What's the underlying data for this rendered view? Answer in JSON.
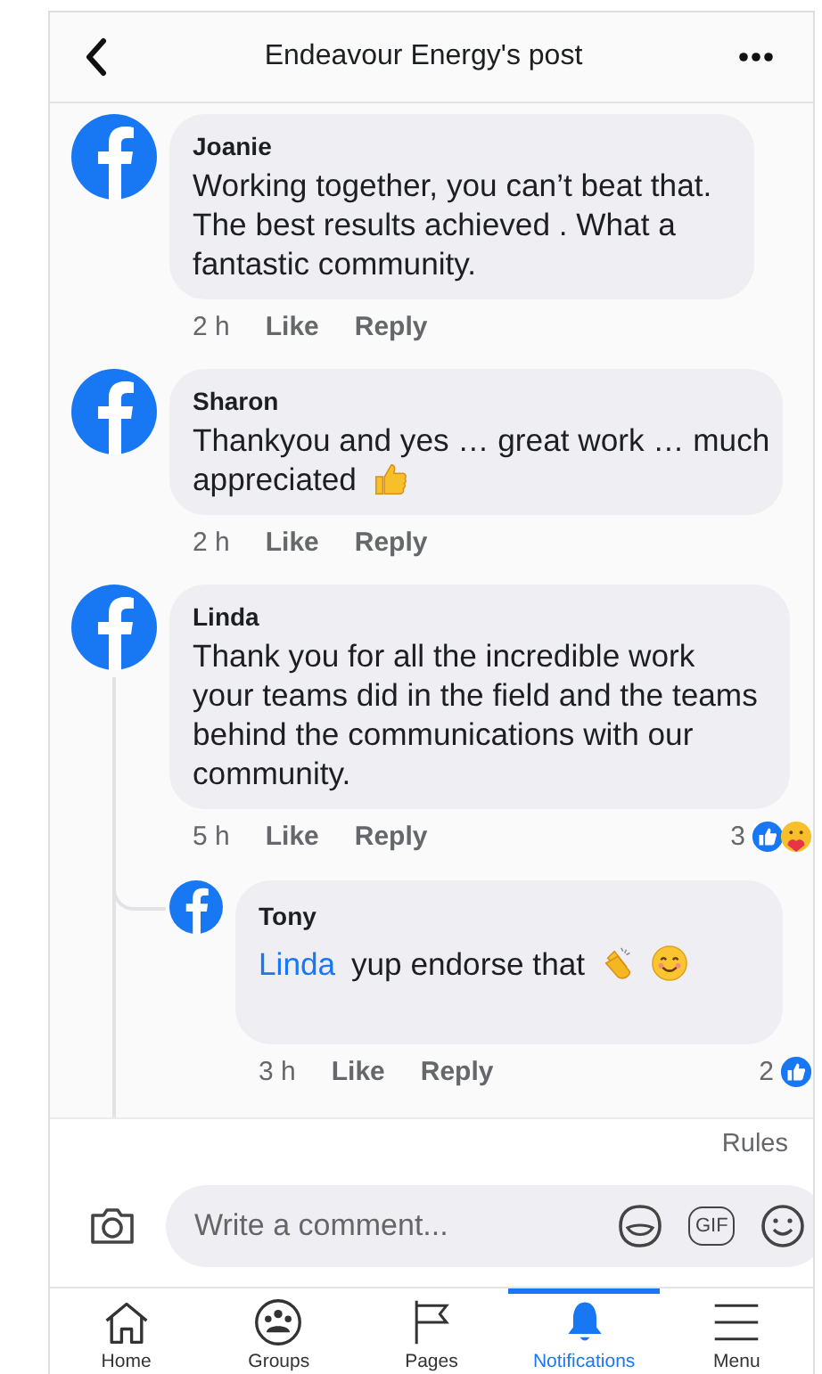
{
  "header": {
    "title": "Endeavour Energy's post"
  },
  "comments": [
    {
      "author": "Joanie",
      "text": "Working together, you can’t beat that. The best results achieved . What a fantastic community.",
      "time": "2 h",
      "actions": [
        "Like",
        "Reply"
      ]
    },
    {
      "author": "Sharon",
      "text": "Thankyou and yes … great work … much appreciated",
      "emoji_thumbs_up": true,
      "time": "2 h",
      "actions": [
        "Like",
        "Reply"
      ]
    },
    {
      "author": "Linda",
      "text": "Thank you for all the incredible work your teams did in the field and the teams behind the communications with our community.",
      "time": "5 h",
      "actions": [
        "Like",
        "Reply"
      ],
      "reactions": {
        "count": "3",
        "like": true,
        "care": true
      },
      "replies": [
        {
          "author": "Tony",
          "mention": "Linda",
          "text": "yup endorse that",
          "emoji_clap": true,
          "emoji_smile": true,
          "time": "3 h",
          "actions": [
            "Like",
            "Reply"
          ],
          "reactions": {
            "count": "2",
            "like": true
          }
        }
      ]
    }
  ],
  "rules_link": "Rules",
  "composer": {
    "placeholder": "Write a comment...",
    "gif_label": "GIF"
  },
  "tabs": [
    {
      "label": "Home",
      "selected": false
    },
    {
      "label": "Groups",
      "selected": false
    },
    {
      "label": "Pages",
      "selected": false
    },
    {
      "label": "Notifications",
      "selected": true
    },
    {
      "label": "Menu",
      "selected": false
    }
  ]
}
